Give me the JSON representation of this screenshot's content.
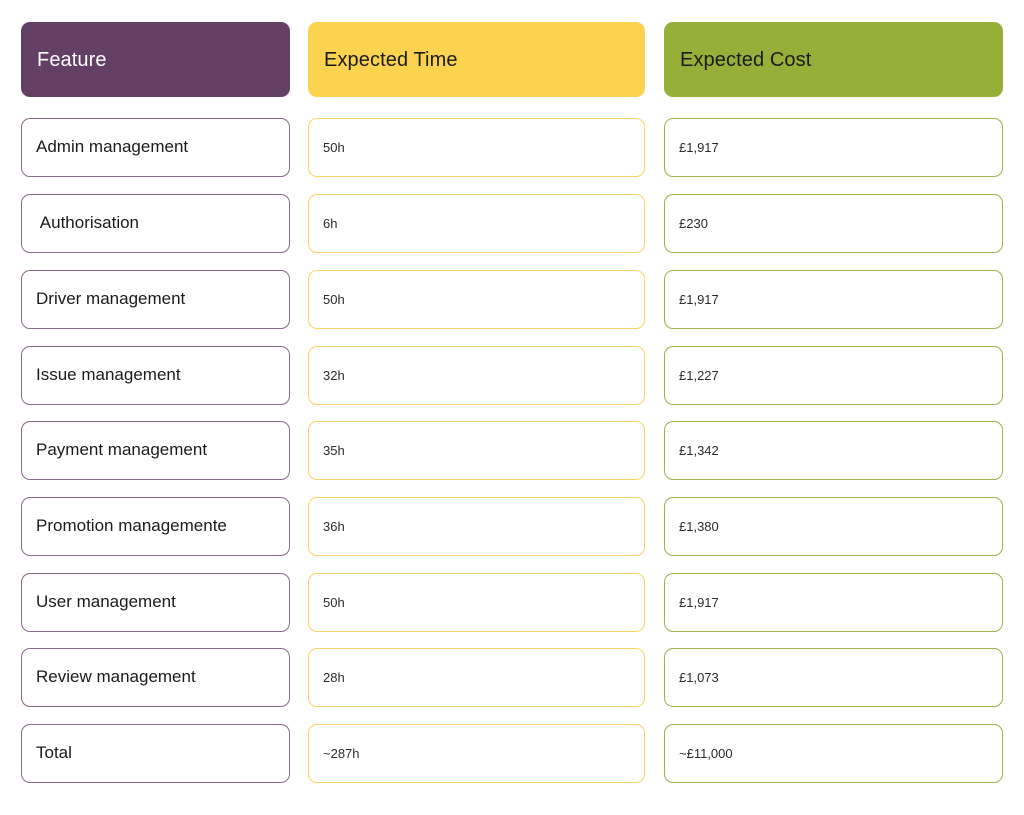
{
  "table": {
    "columns": [
      {
        "key": "feature",
        "header": "Feature",
        "accent": "#633F65",
        "border": "#8A6A8C"
      },
      {
        "key": "time",
        "header": "Expected Time",
        "accent": "#FCD34F",
        "border": "#FBD264"
      },
      {
        "key": "cost",
        "header": "Expected Cost",
        "accent": "#96AF39",
        "border": "#9CB24A"
      }
    ],
    "rows": [
      {
        "feature": "Admin management",
        "time": "50h",
        "cost": "£1,917"
      },
      {
        "feature": " Authorisation",
        "time": "6h",
        "cost": "£230"
      },
      {
        "feature": "Driver management",
        "time": "50h",
        "cost": "£1,917"
      },
      {
        "feature": "Issue management",
        "time": "32h",
        "cost": "£1,227"
      },
      {
        "feature": "Payment management",
        "time": "35h",
        "cost": "£1,342"
      },
      {
        "feature": "Promotion managemente",
        "time": "36h",
        "cost": "£1,380"
      },
      {
        "feature": "User management",
        "time": "50h",
        "cost": "£1,917"
      },
      {
        "feature": "Review management",
        "time": "28h",
        "cost": "£1,073"
      },
      {
        "feature": "Total",
        "time": "~287h",
        "cost": "~£11,000"
      }
    ]
  }
}
